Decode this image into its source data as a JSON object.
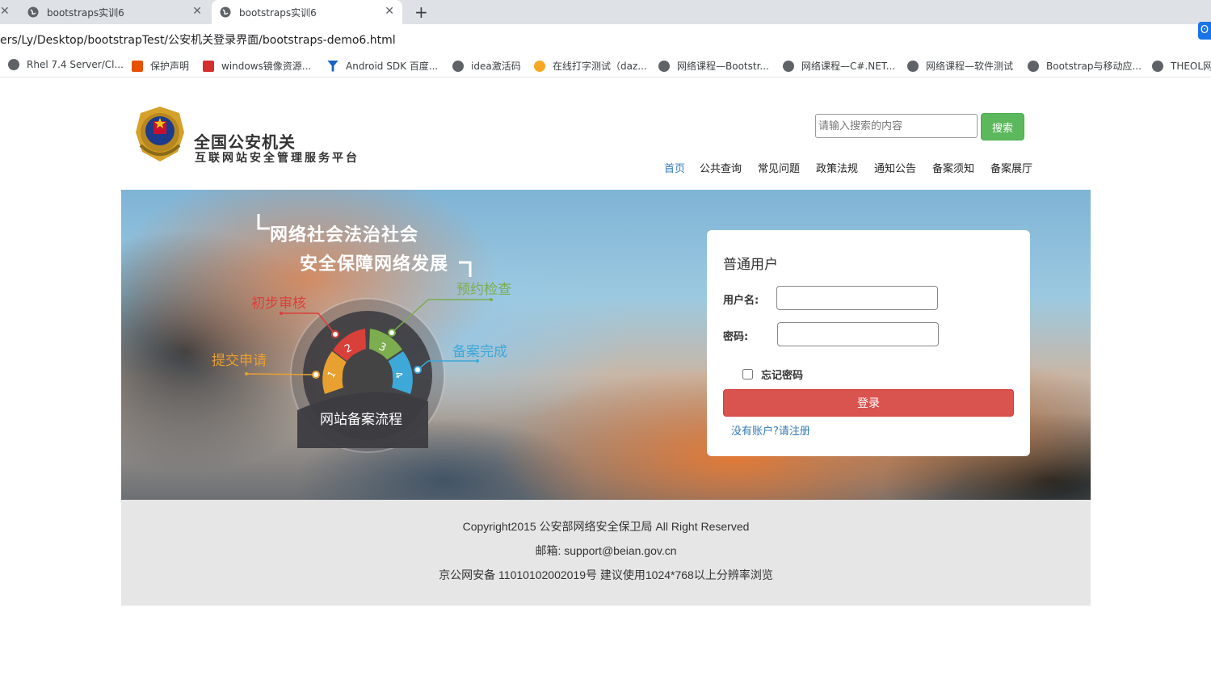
{
  "browser": {
    "tabs": [
      {
        "title": "bootstraps实训6"
      },
      {
        "title": "bootstraps实训6"
      }
    ],
    "url": "ers/Ly/Desktop/bootstrapTest/公安机关登录界面/bootstraps-demo6.html",
    "bookmarks": [
      {
        "label": "Rhel 7.4 Server/Cl...",
        "icon": "globe-icon"
      },
      {
        "label": "保护声明",
        "icon": "red-square-icon"
      },
      {
        "label": "windows镜像资源...",
        "icon": "c-logo-icon"
      },
      {
        "label": "Android SDK 百度...",
        "icon": "filter-icon"
      },
      {
        "label": "idea激活码",
        "icon": "globe-icon"
      },
      {
        "label": "在线打字测试（daz...",
        "icon": "face-icon"
      },
      {
        "label": "网络课程—Bootstr...",
        "icon": "globe-icon"
      },
      {
        "label": "网络课程—C#.NET...",
        "icon": "globe-icon"
      },
      {
        "label": "网络课程—软件测试",
        "icon": "globe-icon"
      },
      {
        "label": "Bootstrap与移动应...",
        "icon": "globe-icon"
      },
      {
        "label": "THEOL网",
        "icon": "globe-icon"
      }
    ]
  },
  "header": {
    "title": "全国公安机关",
    "subtitle": "互联网站安全管理服务平台",
    "search_placeholder": "请输入搜索的内容",
    "search_button": "搜索",
    "nav": [
      "首页",
      "公共查询",
      "常见问题",
      "政策法规",
      "通知公告",
      "备案须知",
      "备案展厅"
    ]
  },
  "banner": {
    "slogan_line1": "网络社会法治社会",
    "slogan_line2": "安全保障网络发展",
    "steps": [
      {
        "num": "1",
        "label": "提交申请",
        "color": "#e8a030"
      },
      {
        "num": "2",
        "label": "初步审核",
        "color": "#d9403a"
      },
      {
        "num": "3",
        "label": "预约检查",
        "color": "#7cad4f"
      },
      {
        "num": "4",
        "label": "备案完成",
        "color": "#3ea8d8"
      }
    ],
    "flow_title": "网站备案流程"
  },
  "login": {
    "title": "普通用户",
    "username_label": "用户名:",
    "password_label": "密码:",
    "remember_label": "忘记密码",
    "submit": "登录",
    "register_link": "没有账户?请注册"
  },
  "footer": {
    "copyright": "Copyright2015 公安部网络安全保卫局 All Right Reserved",
    "email": "邮箱: support@beian.gov.cn",
    "icp": "京公网安备 11010102002019号 建议使用1024*768以上分辨率浏览"
  }
}
